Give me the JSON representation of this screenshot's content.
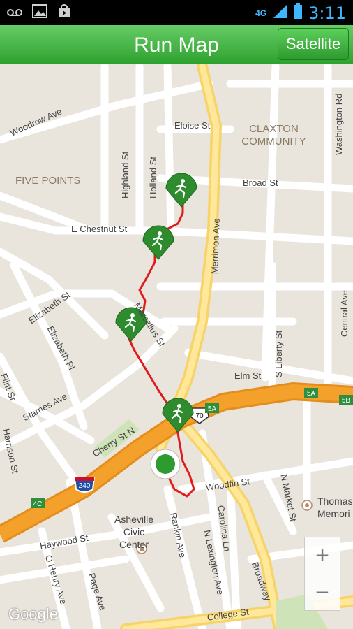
{
  "statusbar": {
    "network": "4G",
    "time": "3:11",
    "icons": [
      "voicemail-icon",
      "image-icon",
      "store-icon",
      "signal-icon",
      "battery-icon"
    ]
  },
  "appbar": {
    "title": "Run Map",
    "satellite_label": "Satellite"
  },
  "map": {
    "streets": {
      "woodrow": "Woodrow Ave",
      "eloise": "Eloise St",
      "broad": "Broad St",
      "chestnut": "E Chestnut St",
      "merrimon": "Merrimon Ave",
      "washington": "Washington Rd",
      "highland": "Highland St",
      "holland": "Holland St",
      "elizabeth_st": "Elizabeth St",
      "elizabeth_pl": "Elizabeth Pl",
      "flint": "Flint St",
      "starnes": "Starnes Ave",
      "harrison": "Harrison St",
      "cherry": "Cherry St N",
      "marcellus": "Marcellus St",
      "elm": "Elm St",
      "liberty": "S Liberty St",
      "central": "Central Ave",
      "woodfin": "Woodfin St",
      "n_market": "N Market St",
      "carolina": "Carolina Ln",
      "n_lexington": "N Lexington Ave",
      "rankin": "Rankin Ave",
      "haywood": "Haywood St",
      "o_henry": "O Henry Ave",
      "page": "Page Ave",
      "broadway": "Broadway",
      "college": "College St"
    },
    "areas": {
      "claxton": "CLAXTON COMMUNITY",
      "five_points": "FIVE POINTS"
    },
    "pois": {
      "civic_center": "Asheville Civic Center",
      "thomas": "Thomas Memori"
    },
    "shields": {
      "i240": "240",
      "us70": "70",
      "exit_5a_a": "5A",
      "exit_5a_b": "5A",
      "exit_5b": "5B",
      "exit_4c": "4C"
    },
    "attribution": "Google",
    "zoom_in": "+",
    "zoom_out": "−"
  },
  "colors": {
    "route": "#e01b1b",
    "marker": "#2e8b2e",
    "highway": "#f4a12c",
    "major_road": "#ffd966",
    "appbar": "#4cb84c"
  }
}
